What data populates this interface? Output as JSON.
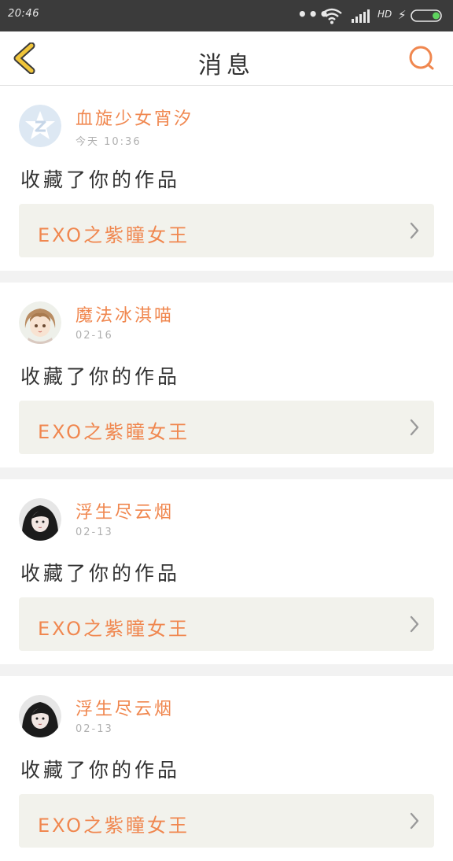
{
  "status_bar": {
    "time": "20:46",
    "dots": "•••",
    "network": "HD"
  },
  "header": {
    "title": "消息"
  },
  "colors": {
    "accent": "#f0874f",
    "back_arrow": "#f0c53a",
    "card_bg": "#ffffff",
    "work_bg": "#f2f2ec"
  },
  "messages": [
    {
      "user": "血旋少女宵汐",
      "time": "今天 10:36",
      "action": "收藏了你的作品",
      "work_title": "EXO之紫瞳女王",
      "avatar_icon": "qq-default-avatar-icon"
    },
    {
      "user": "魔法冰淇喵",
      "time": "02-16",
      "action": "收藏了你的作品",
      "work_title": "EXO之紫瞳女王",
      "avatar_icon": "anime-girl-avatar"
    },
    {
      "user": "浮生尽云烟",
      "time": "02-13",
      "action": "收藏了你的作品",
      "work_title": "EXO之紫瞳女王",
      "avatar_icon": "dark-hair-girl-avatar"
    },
    {
      "user": "浮生尽云烟",
      "time": "02-13",
      "action": "收藏了你的作品",
      "work_title": "EXO之紫瞳女王",
      "avatar_icon": "dark-hair-girl-avatar"
    }
  ]
}
